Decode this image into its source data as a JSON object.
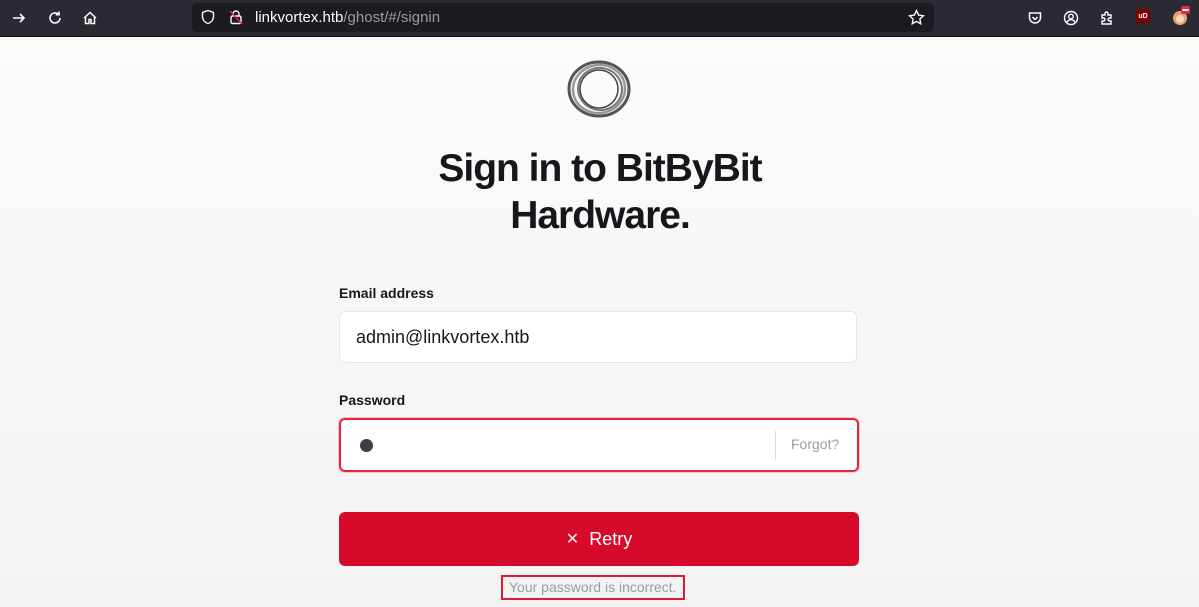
{
  "browser": {
    "url_host": "linkvortex.htb",
    "url_path": "/ghost/#/signin",
    "extension_badge": "uD"
  },
  "signin": {
    "title": "Sign in to BitByBit Hardware.",
    "email_label": "Email address",
    "email_value": "admin@linkvortex.htb",
    "password_label": "Password",
    "forgot_label": "Forgot?",
    "retry_label": "Retry",
    "error_message": "Your password is incorrect."
  },
  "colors": {
    "primary_button": "#d60b2b",
    "error_border": "#e8243d",
    "toolbar_bg": "#2b2a33"
  }
}
